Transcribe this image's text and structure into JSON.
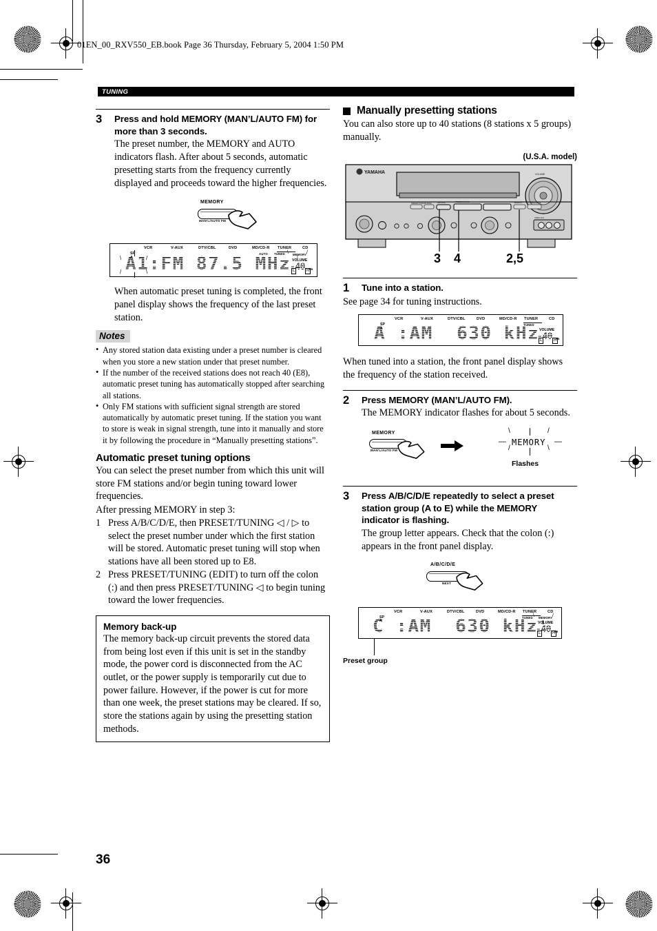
{
  "page": {
    "file_header": "01EN_00_RXV550_EB.book  Page 36  Thursday, February 5, 2004  1:50 PM",
    "section_tab": "TUNING",
    "page_number": "36"
  },
  "left_column": {
    "step3": {
      "num": "3",
      "title": "Press and hold MEMORY (MAN’L/AUTO FM) for more than 3 seconds.",
      "body": "The preset number, the MEMORY and AUTO indicators flash. After about 5 seconds, automatic presetting starts from the frequency currently displayed and proceeds toward the higher frequencies."
    },
    "memory_button_art": {
      "label": "MEMORY",
      "sublabel": "MAN'L/AUTO FM"
    },
    "display_fm": {
      "sources": [
        "VCR",
        "V-AUX",
        "DTV/CBL",
        "DVD",
        "MD/CD-R",
        "TUNER",
        "CD"
      ],
      "sub_indicators": [
        "AUTO",
        "TUNED",
        "MEMORY"
      ],
      "sp_label": "SP",
      "sp_sub": "A",
      "main_text": "A1:FM 87.5 MHz",
      "volume_label": "VOLUME",
      "volume_value": "-40",
      "volume_unit": "dB",
      "channel_l": "L",
      "channel_r": "R"
    },
    "after_display_text": "When automatic preset tuning is completed, the front panel display shows the frequency of the last preset station.",
    "notes_label": "Notes",
    "notes": [
      "Any stored station data existing under a preset number is cleared when you store a new station under that preset number.",
      "If the number of the received stations does not reach 40 (E8), automatic preset tuning has automatically stopped after searching all stations.",
      "Only FM stations with sufficient signal strength are stored automatically by automatic preset tuning. If the station you want to store is weak in signal strength, tune into it manually and store it by following the procedure in “Manually presetting stations”."
    ],
    "options_heading": "Automatic preset tuning options",
    "options_intro": "You can select the preset number from which this unit will store FM stations and/or begin tuning toward lower frequencies.",
    "options_after": "After pressing MEMORY in step 3:",
    "options_list": [
      {
        "n": "1",
        "text": "Press A/B/C/D/E, then PRESET/TUNING ◁ / ▷ to select the preset number under which the first station will be stored. Automatic preset tuning will stop when stations have all been stored up to E8."
      },
      {
        "n": "2",
        "text": "Press PRESET/TUNING (EDIT) to turn off the colon (:) and then press PRESET/TUNING ◁ to begin tuning toward the lower frequencies."
      }
    ],
    "backup_box": {
      "title": "Memory back-up",
      "text": "The memory back-up circuit prevents the stored data from being lost even if this unit is set in the standby mode, the power cord is disconnected from the AC outlet, or the power supply is temporarily cut due to power failure. However, if the power is cut for more than one week, the preset stations may be cleared. If so, store the stations again by using the presetting station methods."
    }
  },
  "right_column": {
    "heading": "Manually presetting stations",
    "intro": "You can also store up to 40 stations (8 stations x 5 groups) manually.",
    "model_note": "(U.S.A. model)",
    "receiver": {
      "brand": "YAMAHA",
      "callouts": [
        "3",
        "4",
        "2,5"
      ]
    },
    "step1": {
      "num": "1",
      "title": "Tune into a station.",
      "body": "See page 34 for tuning instructions."
    },
    "display_am1": {
      "sources": [
        "VCR",
        "V-AUX",
        "DTV/CBL",
        "DVD",
        "MD/CD-R",
        "TUNER",
        "CD"
      ],
      "sub_indicators": [
        "TUNED"
      ],
      "sp_label": "SP",
      "sp_sub": "A",
      "main_text": "A :AM  630 kHz",
      "volume_label": "VOLUME",
      "volume_value": "-40",
      "volume_unit": "dB",
      "channel_l": "L",
      "channel_r": "R"
    },
    "after_display_text": "When tuned into a station, the front panel display shows the frequency of the station received.",
    "step2": {
      "num": "2",
      "title": "Press MEMORY (MAN’L/AUTO FM).",
      "body": "The MEMORY indicator flashes for about 5 seconds."
    },
    "memory_button_art": {
      "label": "MEMORY",
      "sublabel": "MAN'L/AUTO FM",
      "flashing_indicator": "MEMORY",
      "caption": "Flashes"
    },
    "step3": {
      "num": "3",
      "title": "Press A/B/C/D/E repeatedly to select a preset station group (A to E) while the MEMORY indicator is flashing.",
      "body": "The group letter appears. Check that the colon (:) appears in the front panel display."
    },
    "abcde_button_art": {
      "label": "A/B/C/D/E",
      "sublabel": "NEXT"
    },
    "display_am2": {
      "sources": [
        "VCR",
        "V-AUX",
        "DTV/CBL",
        "DVD",
        "MD/CD-R",
        "TUNER",
        "CD"
      ],
      "sub_indicators": [
        "TUNED",
        "MEMORY"
      ],
      "sp_label": "SP",
      "sp_sub": "A",
      "main_text": "C :AM  630 kHz",
      "volume_label": "VOLUME",
      "volume_value": "-40",
      "volume_unit": "dB",
      "channel_l": "L",
      "channel_r": "R"
    },
    "preset_group_caption": "Preset group"
  }
}
